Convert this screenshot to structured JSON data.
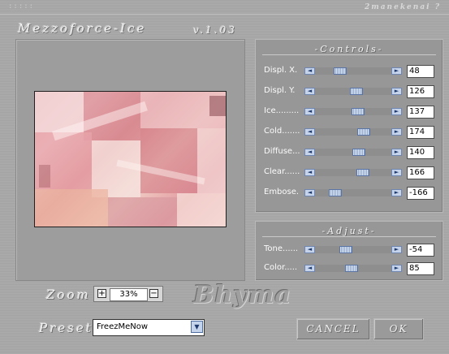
{
  "header": {
    "dots": ":::::",
    "brand": "2manekenai ?",
    "title": "Mezzoforce-Ice",
    "version": "v.1.03"
  },
  "controls": {
    "title": "-Controls-",
    "rows": [
      {
        "label": "Displ. X.",
        "value": "48",
        "level": 0.3
      },
      {
        "label": "Displ. Y.",
        "value": "126",
        "level": 0.55
      },
      {
        "label": "Ice.........",
        "value": "137",
        "level": 0.58
      },
      {
        "label": "Cold.......",
        "value": "174",
        "level": 0.67
      },
      {
        "label": "Diffuse...",
        "value": "140",
        "level": 0.59
      },
      {
        "label": "Clear......",
        "value": "166",
        "level": 0.66
      },
      {
        "label": "Embose.",
        "value": "-166",
        "level": 0.22
      }
    ]
  },
  "adjust": {
    "title": "-Adjust-",
    "rows": [
      {
        "label": "Tone......",
        "value": "-54",
        "level": 0.38
      },
      {
        "label": "Color.....",
        "value": "85",
        "level": 0.47
      }
    ]
  },
  "zoom": {
    "label": "Zoom",
    "value": "33%",
    "plus": "+",
    "minus": "−"
  },
  "logo": "Bhyma",
  "preset": {
    "label": "Preset",
    "value": "FreezMeNow",
    "arrow": "▼"
  },
  "buttons": {
    "cancel": "CANCEL",
    "ok": "OK"
  },
  "icons": {
    "arrow_left": "◄",
    "arrow_right": "►"
  },
  "colors": {
    "background": "#a7a7a7",
    "panel": "#979797",
    "slider_accent": "#c5d4ea"
  }
}
